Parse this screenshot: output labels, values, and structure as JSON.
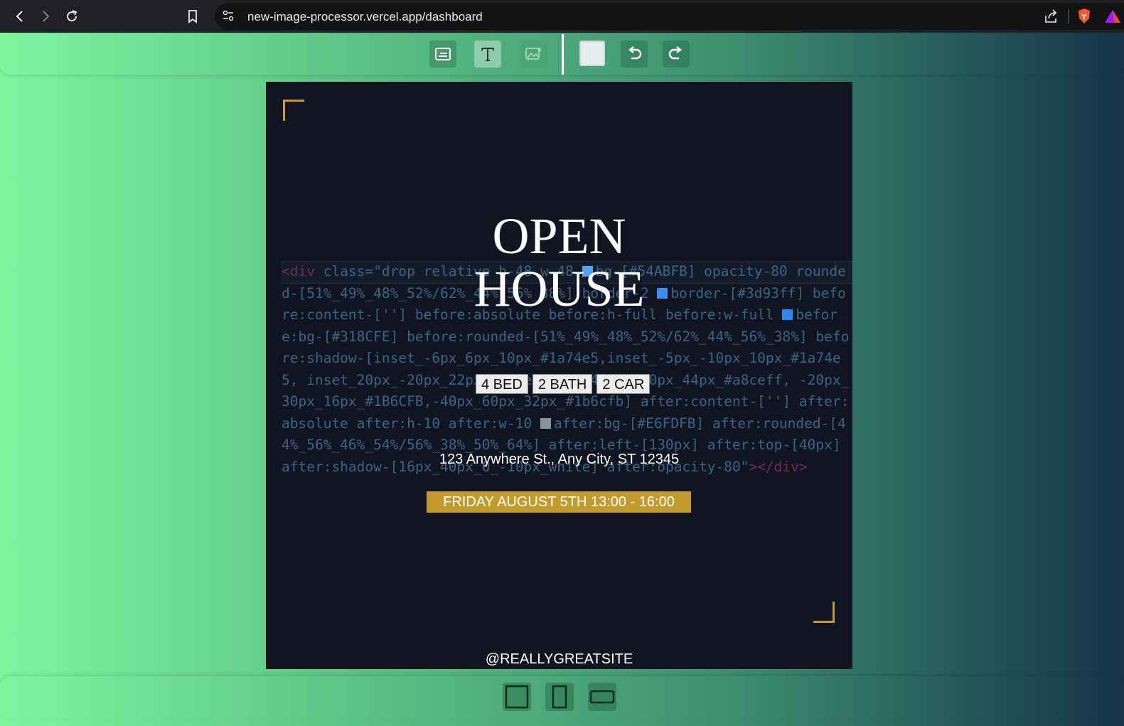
{
  "browser": {
    "url": "new-image-processor.vercel.app/dashboard",
    "icons": [
      "back-icon",
      "forward-icon",
      "reload-icon",
      "bookmark-icon",
      "site-settings-icon",
      "share-icon",
      "brave-shield-icon",
      "brave-rewards-icon"
    ]
  },
  "toolbar": {
    "buttons": [
      "background-icon",
      "text-icon",
      "image-icon",
      "color-swatch",
      "undo-icon",
      "redo-icon"
    ],
    "swatch_color": "#e9ecef"
  },
  "poster": {
    "title_line1": "OPEN",
    "title_line2": "HOUSE",
    "tags": [
      "4 BED",
      "2 BATH",
      "2 CAR"
    ],
    "address": "123 Anywhere St., Any City, ST 12345",
    "date": "FRIDAY AUGUST 5TH 13:00 - 16:00",
    "handle": "@REALLYGREATSITE",
    "background_color": "#111522",
    "accent_color": "#c39a2c"
  },
  "code_overlay": {
    "open_tag": "<div",
    "text_a": " class=\"drop relative h-48 w-48 ",
    "text_b": "bg-[#54ABFB] opacity-80 rounded-[51%_49%_48%_52%/62%_44%_56%_38%] border-2 ",
    "text_c": "border-[#3d93ff] before:content-[''] before:absolute before:h-full before:w-full ",
    "text_d": "before:bg-[#318CFE] before:rounded-[51%_49%_48%_52%/62%_44%_56%_38%] before:shadow-[inset_-6px_6px_10px_#1a74e5,inset_-5px_-10px_10px_#1a74e5, inset_20px_-20px_22px_white,inset_40px_-40px_44px_#a8ceff, -20px_30px_16px_#1B6CFB,-40px_60px_32px_#1b6cfb] after:content-[''] after:absolute after:h-10 after:w-10 ",
    "text_e": "after:bg-[#E6FDFB] after:rounded-[44%_56%_46%_54%/56%_38%_50%_64%] after:left-[130px] after:top-[40px] after:shadow-[16px_40px_0_-10px_white] after:opacity-80\"",
    "close_tag": "></div>",
    "swatch_colors": [
      "#54ABFB",
      "#3d93ff",
      "#318CFE",
      "#E6FDFB"
    ]
  },
  "bottombar": {
    "buttons": [
      "square-format-icon",
      "portrait-format-icon",
      "landscape-format-icon"
    ]
  }
}
